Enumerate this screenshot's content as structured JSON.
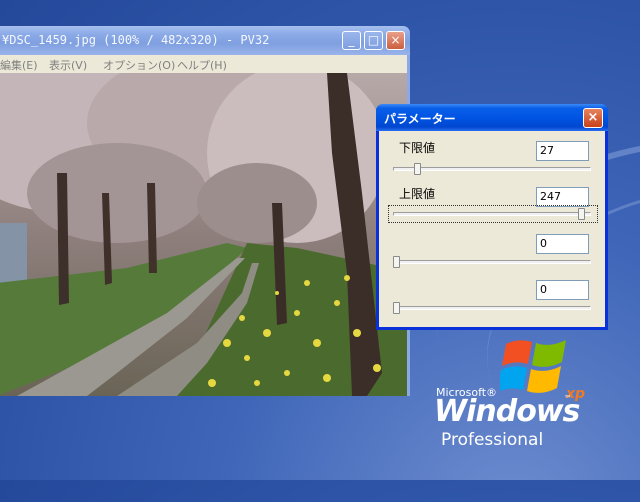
{
  "viewer": {
    "title": "¥DSC_1459.jpg (100% / 482x320) - PV32",
    "menu": [
      "編集(E)",
      "表示(V)",
      "オプション(O)",
      "ヘルプ(H)"
    ],
    "buttons": {
      "minimize": "_",
      "maximize": "□",
      "close": "×"
    }
  },
  "dialog": {
    "title": "パラメーター",
    "close": "×",
    "params": [
      {
        "label": "下限値",
        "value": "27",
        "level": 0.11
      },
      {
        "label": "上限値",
        "value": "247",
        "level": 0.97
      },
      {
        "label": "",
        "value": "0",
        "level": 0.0
      },
      {
        "label": "",
        "value": "0",
        "level": 0.0
      }
    ]
  },
  "desktop": {
    "logo": {
      "microsoft": "Microsoft®",
      "windows": "Windows",
      "xp": "xp",
      "tm": "™",
      "edition": "Professional"
    }
  },
  "colors": {
    "dialog_title": "#0054e3",
    "viewer_title_inactive": "#8aa9e6",
    "desktop": "#3a62b5"
  }
}
